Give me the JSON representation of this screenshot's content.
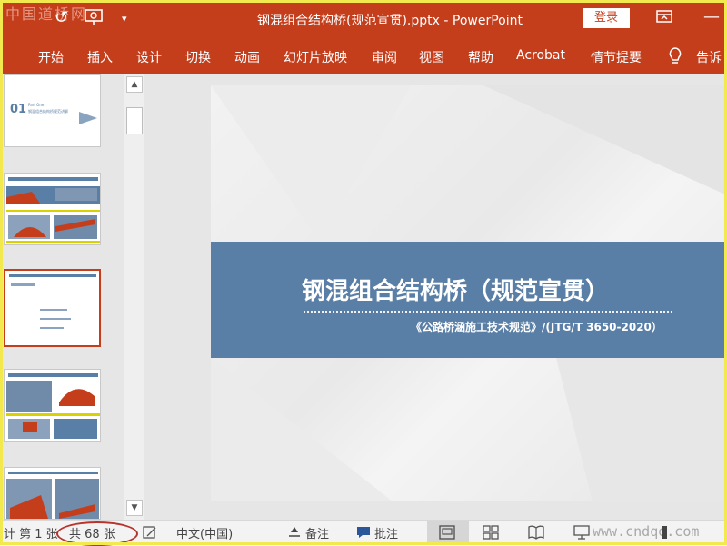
{
  "watermark": {
    "site": "中国道桥网",
    "url": "www.cndqo.com"
  },
  "titlebar": {
    "doc_title": "钢混组合结构桥(规范宣贯).pptx  -  PowerPoint",
    "login": "登录",
    "qa_more": "▾"
  },
  "ribbon": {
    "tabs": [
      "开始",
      "插入",
      "设计",
      "切换",
      "动画",
      "幻灯片放映",
      "审阅",
      "视图",
      "帮助",
      "Acrobat",
      "情节提要"
    ],
    "tell_me": "告诉"
  },
  "thumbs": {
    "slide1": {
      "num": "01",
      "heading": "Part One",
      "desc": "钢混组合结构桥规范讲解"
    }
  },
  "slide": {
    "title": "钢混组合结构桥（规范宣贯）",
    "subtitle": "《公路桥涵施工技术规范》/(JTG/T 3650-2020）",
    "band_color": "#5a7fa6"
  },
  "status": {
    "slide_num": "计 第 1 张",
    "total": "共 68 张",
    "language": "中文(中国)",
    "notes": "备注",
    "comments": "批注"
  },
  "colors": {
    "accent": "#c43e1c",
    "highlight_border": "#f2e94e",
    "annotation_oval": "#b7332c"
  }
}
